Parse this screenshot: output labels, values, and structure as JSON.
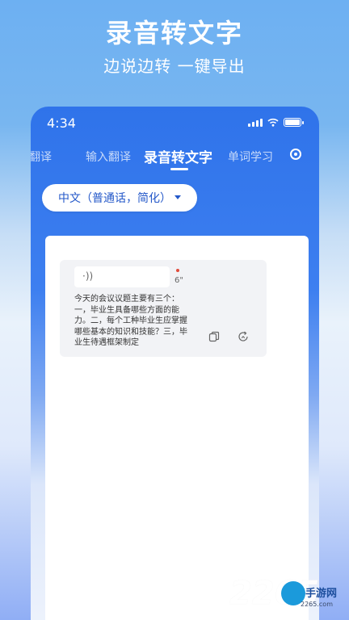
{
  "promo": {
    "title": "录音转文字",
    "subtitle": "边说边转 一键导出"
  },
  "status_bar": {
    "time": "4:34"
  },
  "tabs": [
    {
      "label": "翻译"
    },
    {
      "label": "输入翻译"
    },
    {
      "label": "录音转文字",
      "active": true
    },
    {
      "label": "单词学习"
    }
  ],
  "language_selector": {
    "value": "中文（普通话，简化）"
  },
  "message": {
    "audio_duration": "6\"",
    "transcript": "今天的会议议题主要有三个：一，毕业生具备哪些方面的能力。二，每个工种毕业生应掌握哪些基本的知识和技能？三，毕业生待遇框架制定"
  },
  "watermark": {
    "number": "2265",
    "brand": "手游网",
    "url": "2265.com"
  },
  "colors": {
    "accent": "#2f73ea",
    "selector_text": "#2458c9"
  }
}
